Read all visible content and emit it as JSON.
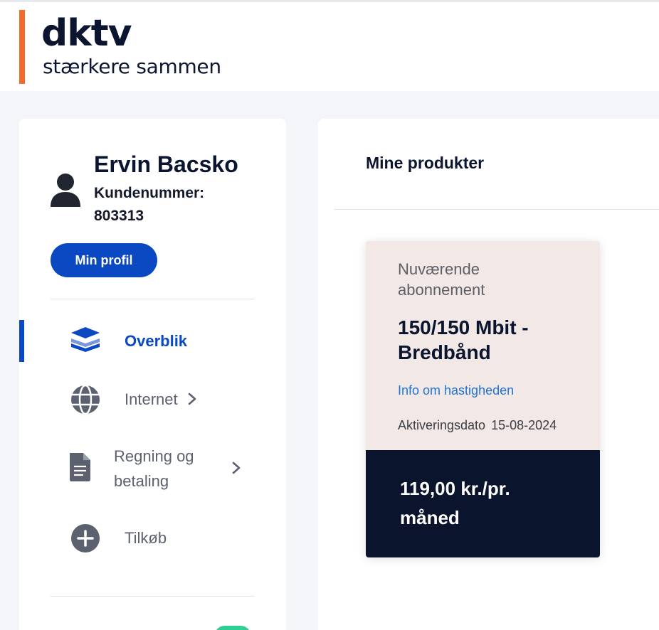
{
  "brand": {
    "name": "dktv",
    "tagline": "stærkere sammen",
    "accent_color": "#f26b2a"
  },
  "user": {
    "name": "Ervin Bacsko",
    "customer_label": "Kundenummer:",
    "customer_number": "803313",
    "avatar_icon": "person-icon",
    "profile_button": "Min profil"
  },
  "nav": {
    "items": [
      {
        "label": "Overblik",
        "icon": "layers-icon",
        "active": true
      },
      {
        "label": "Internet",
        "icon": "globe-icon",
        "active": false
      },
      {
        "label_line1": "Regning og",
        "label_line2": "betaling",
        "icon": "document-icon",
        "active": false
      },
      {
        "label": "Tilkøb",
        "icon": "plus-circle-icon",
        "active": false
      }
    ]
  },
  "main": {
    "title": "Mine produkter",
    "product": {
      "subtitle": "Nuværende abonnement",
      "name": "150/150 Mbit - Bredbånd",
      "info_link": "Info om hastigheden",
      "activation_label": "Aktiveringsdato",
      "activation_date": "15-08-2024",
      "price": "119,00 kr./pr. måned"
    }
  },
  "colors": {
    "primary": "#0a49c2",
    "card_top": "#f2e8e5",
    "card_bottom": "#0a142d",
    "toggle_on": "#2ecf93"
  }
}
